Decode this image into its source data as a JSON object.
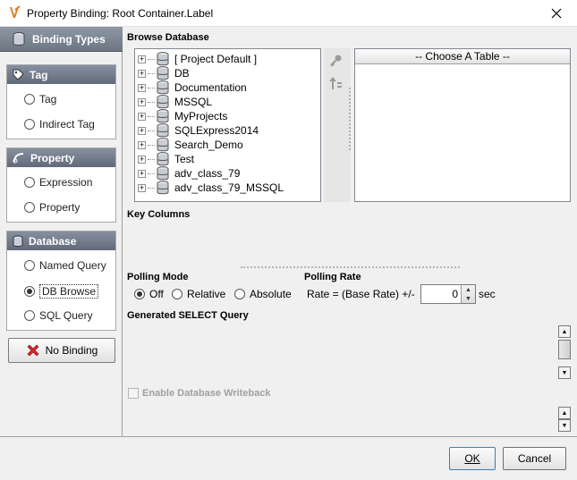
{
  "window": {
    "title": "Property Binding: Root Container.Label"
  },
  "left_panel": {
    "header": "Binding Types",
    "groups": [
      {
        "title": "Tag",
        "icon": "tag-icon",
        "options": [
          "Tag",
          "Indirect Tag"
        ]
      },
      {
        "title": "Property",
        "icon": "property-icon",
        "options": [
          "Expression",
          "Property"
        ]
      },
      {
        "title": "Database",
        "icon": "database-icon",
        "options": [
          "Named Query",
          "DB Browse",
          "SQL Query"
        ]
      }
    ],
    "selected": "DB Browse",
    "no_binding": "No Binding"
  },
  "browse": {
    "label": "Browse Database",
    "items": [
      "[ Project Default ]",
      "DB",
      "Documentation",
      "MSSQL",
      "MyProjects",
      "SQLExpress2014",
      "Search_Demo",
      "Test",
      "adv_class_79",
      "adv_class_79_MSSQL"
    ]
  },
  "table_picker": {
    "label": "-- Choose A Table --"
  },
  "key_columns": {
    "label": "Key Columns"
  },
  "polling": {
    "mode_label": "Polling Mode",
    "modes": [
      "Off",
      "Relative",
      "Absolute"
    ],
    "selected_mode": "Off",
    "rate_label": "Polling Rate",
    "rate_text": "Rate = (Base Rate) +/-",
    "rate_value": "0",
    "rate_unit": "sec"
  },
  "query": {
    "label": "Generated SELECT Query"
  },
  "writeback": {
    "label": "Enable Database Writeback",
    "checked": false
  },
  "footer": {
    "ok": "OK",
    "cancel": "Cancel"
  }
}
